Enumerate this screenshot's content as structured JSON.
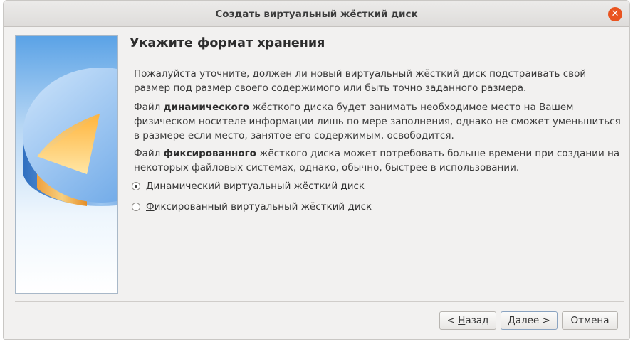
{
  "window": {
    "title": "Создать виртуальный жёсткий диск"
  },
  "page": {
    "heading": "Укажите формат хранения",
    "para1": "Пожалуйста уточните, должен ли новый виртуальный жёсткий диск подстраивать свой размер под размер своего содержимого или быть точно заданного размера.",
    "para2": {
      "prefix": "Файл ",
      "bold": "динамического",
      "suffix": " жёсткого диска будет занимать необходимое место на Вашем физическом носителе информации лишь по мере заполнения, однако не сможет уменьшиться в размере если место, занятое его содержимым, освободится."
    },
    "para3": {
      "prefix": "Файл ",
      "bold": "фиксированного",
      "suffix": " жёсткого диска может потребовать больше времени при создании на некоторых файловых системах, однако, обычно, быстрее в использовании."
    },
    "options": [
      {
        "label_first": "Д",
        "label_rest": "инамический виртуальный жёсткий диск",
        "checked": true
      },
      {
        "label_first": "Ф",
        "label_rest": "иксированный виртуальный жёсткий диск",
        "checked": false
      }
    ]
  },
  "buttons": {
    "back_prefix": "< ",
    "back_mnemonic": "Н",
    "back_rest": "азад",
    "next_mnemonic": "Д",
    "next_rest": "алее >",
    "cancel": "Отмена"
  }
}
